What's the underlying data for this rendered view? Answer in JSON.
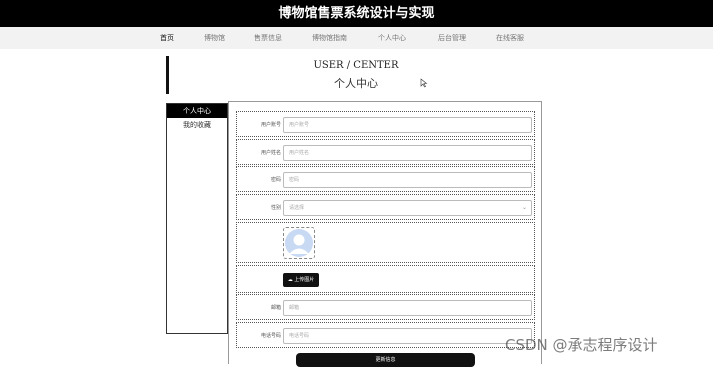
{
  "app": {
    "title": "博物馆售票系统设计与实现"
  },
  "nav": {
    "items": [
      {
        "label": "首页"
      },
      {
        "label": "博物馆"
      },
      {
        "label": "售票信息"
      },
      {
        "label": "博物馆指南"
      },
      {
        "label": "个人中心"
      },
      {
        "label": "后台管理"
      },
      {
        "label": "在线客服"
      }
    ],
    "active_index": 0
  },
  "page": {
    "title_en": "USER / CENTER",
    "title_cn": "个人中心"
  },
  "sidebar": {
    "items": [
      {
        "label": "个人中心"
      },
      {
        "label": "我的收藏"
      }
    ]
  },
  "form": {
    "username": {
      "label": "用户账号",
      "placeholder": "用户账号"
    },
    "name": {
      "label": "用户姓名",
      "placeholder": "用户姓名"
    },
    "password": {
      "label": "密码",
      "placeholder": "密码"
    },
    "gender": {
      "label": "性别",
      "value": "请选择"
    },
    "upload_label": "上传图片",
    "email": {
      "label": "邮箱",
      "placeholder": "邮箱"
    },
    "phone": {
      "label": "电话号码",
      "placeholder": "电话号码"
    },
    "submit_label": "更新信息"
  },
  "watermark": "CSDN @承志程序设计",
  "colors": {
    "primary": "#000000",
    "nav_bg": "#f2f2f2",
    "border": "#555555"
  }
}
